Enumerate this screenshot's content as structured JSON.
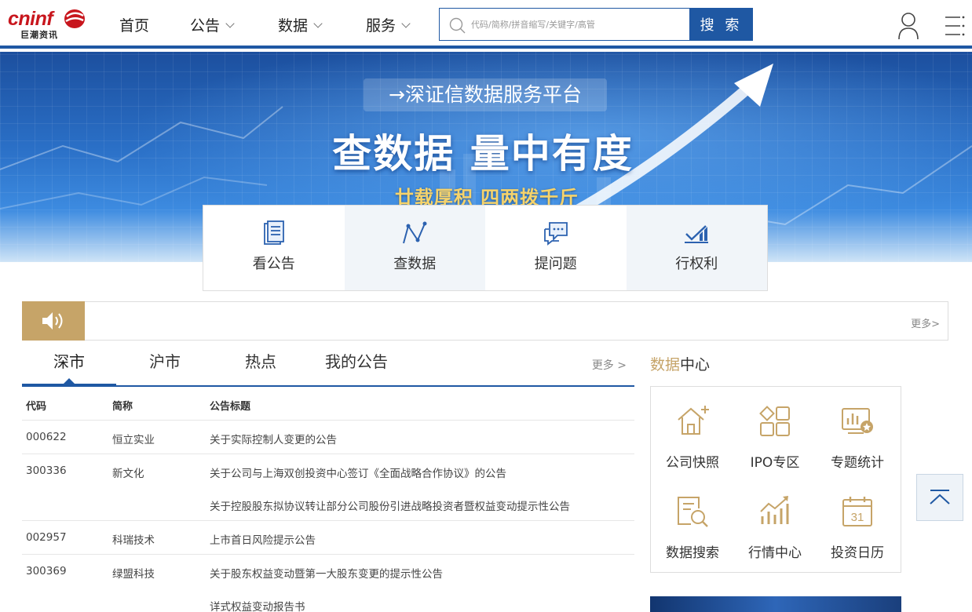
{
  "header": {
    "logo_word": "cninf",
    "logo_sub": "巨潮资讯",
    "nav": [
      "首页",
      "公告",
      "数据",
      "服务"
    ],
    "search_placeholder": "代码/简称/拼音缩写/关键字/高管",
    "search_button": "搜 索",
    "user_icon": "user-icon",
    "menu_icon": "menu-icon"
  },
  "banner": {
    "tag": "→深证信数据服务平台",
    "title": "查数据 量中有度",
    "subtitle": "廿载厚积 四两拨千斤"
  },
  "quick_entries": [
    {
      "label": "看公告",
      "icon": "document-icon"
    },
    {
      "label": "查数据",
      "icon": "line-chart-icon"
    },
    {
      "label": "提问题",
      "icon": "chat-icon"
    },
    {
      "label": "行权利",
      "icon": "check-chart-icon"
    }
  ],
  "notice": {
    "speaker_icon": "speaker-icon",
    "more": "更多>"
  },
  "tabs": {
    "items": [
      "深市",
      "沪市",
      "热点",
      "我的公告"
    ],
    "active": "深市",
    "more": "更多 >"
  },
  "table": {
    "headers": [
      "代码",
      "简称",
      "公告标题"
    ],
    "rows": [
      {
        "code": "000622",
        "name": "恒立实业",
        "titles": [
          "关于实际控制人变更的公告"
        ]
      },
      {
        "code": "300336",
        "name": "新文化",
        "titles": [
          "关于公司与上海双创投资中心签订《全面战略合作协议》的公告",
          "关于控股股东拟协议转让部分公司股份引进战略投资者暨权益变动提示性公告"
        ]
      },
      {
        "code": "002957",
        "name": "科瑞技术",
        "titles": [
          "上市首日风险提示公告"
        ]
      },
      {
        "code": "300369",
        "name": "绿盟科技",
        "titles": [
          "关于股东权益变动暨第一大股东变更的提示性公告",
          "详式权益变动报告书"
        ]
      }
    ]
  },
  "data_center": {
    "title_accent": "数据",
    "title_rest": "中心",
    "items": [
      {
        "label": "公司快照",
        "icon": "company-snapshot-icon"
      },
      {
        "label": "IPO专区",
        "icon": "ipo-grid-icon"
      },
      {
        "label": "专题统计",
        "icon": "statistics-icon"
      },
      {
        "label": "数据搜索",
        "icon": "data-search-icon"
      },
      {
        "label": "行情中心",
        "icon": "market-icon"
      },
      {
        "label": "投资日历",
        "icon": "calendar-icon",
        "day": "31"
      }
    ]
  },
  "colors": {
    "brand_blue": "#1f58a3",
    "accent_gold": "#c6a468",
    "logo_red": "#c8161d"
  }
}
